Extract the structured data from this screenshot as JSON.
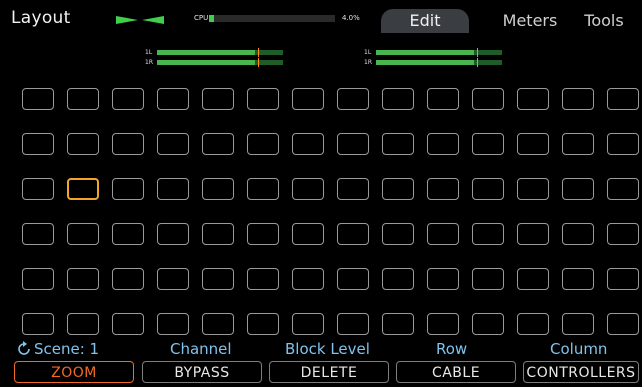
{
  "header": {
    "title": "Layout",
    "cpu": {
      "label": "CPU",
      "value_text": "4.0%",
      "level": 0.04
    },
    "tabs": [
      {
        "label": "Edit",
        "active": true
      },
      {
        "label": "Meters",
        "active": false
      },
      {
        "label": "Tools",
        "active": false
      }
    ]
  },
  "meters": [
    {
      "channels": [
        {
          "label": "1L",
          "level": 0.78,
          "peak": 0.8
        },
        {
          "label": "1R",
          "level": 0.78,
          "peak": 0.8
        }
      ]
    },
    {
      "channels": [
        {
          "label": "1L",
          "level": 0.78,
          "peak": 0.8
        },
        {
          "label": "1R",
          "level": 0.78,
          "peak": 0.8
        }
      ]
    }
  ],
  "grid": {
    "rows": 6,
    "cols": 14,
    "selected": {
      "row": 3,
      "col": 2
    }
  },
  "status": {
    "scene": "Scene: 1",
    "channel": "Channel",
    "block_level": "Block Level",
    "row": "Row",
    "column": "Column"
  },
  "buttons": [
    {
      "label": "ZOOM",
      "active": true
    },
    {
      "label": "BYPASS",
      "active": false
    },
    {
      "label": "DELETE",
      "active": false
    },
    {
      "label": "CABLE",
      "active": false
    },
    {
      "label": "CONTROLLERS",
      "active": false
    }
  ],
  "colors": {
    "accent": "#f06a26",
    "selected_block": "#f2a52a",
    "status_text": "#7fc3ee",
    "meter_green": "#48b54f",
    "cpu_green": "#3fcf4a"
  },
  "icons": {
    "io": "io-arrows-icon",
    "scene": "refresh-arrow-icon"
  }
}
